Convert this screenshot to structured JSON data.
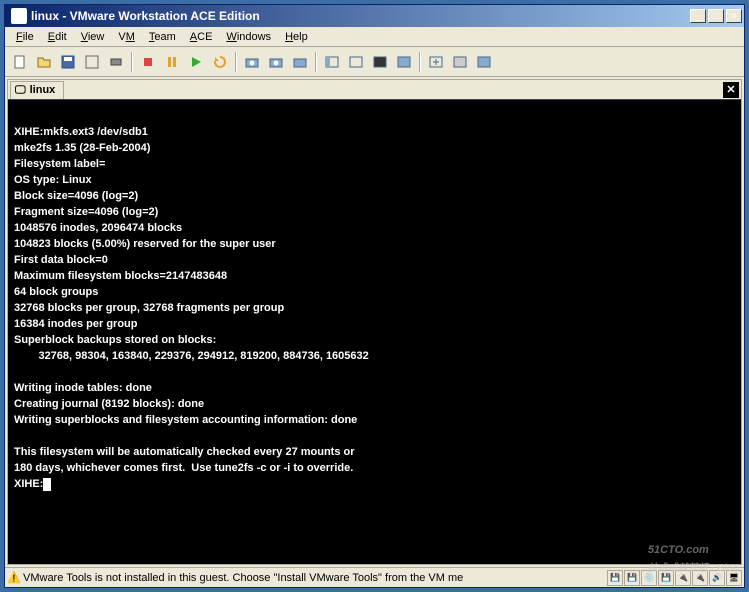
{
  "title": "linux - VMware Workstation ACE Edition",
  "menu": {
    "file": "File",
    "edit": "Edit",
    "view": "View",
    "vm": "VM",
    "team": "Team",
    "ace": "ACE",
    "windows": "Windows",
    "help": "Help"
  },
  "tab": {
    "label": "linux"
  },
  "terminal": {
    "lines": [
      "XIHE:mkfs.ext3 /dev/sdb1",
      "mke2fs 1.35 (28-Feb-2004)",
      "Filesystem label=",
      "OS type: Linux",
      "Block size=4096 (log=2)",
      "Fragment size=4096 (log=2)",
      "1048576 inodes, 2096474 blocks",
      "104823 blocks (5.00%) reserved for the super user",
      "First data block=0",
      "Maximum filesystem blocks=2147483648",
      "64 block groups",
      "32768 blocks per group, 32768 fragments per group",
      "16384 inodes per group",
      "Superblock backups stored on blocks:",
      "        32768, 98304, 163840, 229376, 294912, 819200, 884736, 1605632",
      "",
      "Writing inode tables: done",
      "Creating journal (8192 blocks): done",
      "Writing superblocks and filesystem accounting information: done",
      "",
      "This filesystem will be automatically checked every 27 mounts or",
      "180 days, whichever comes first.  Use tune2fs -c or -i to override.",
      "XIHE:"
    ]
  },
  "status": {
    "text": "VMware Tools is not installed in this guest. Choose \"Install VMware Tools\" from the VM me"
  },
  "watermark": {
    "main": "51CTO.com",
    "sub": "技术成就梦想 · Blog"
  }
}
